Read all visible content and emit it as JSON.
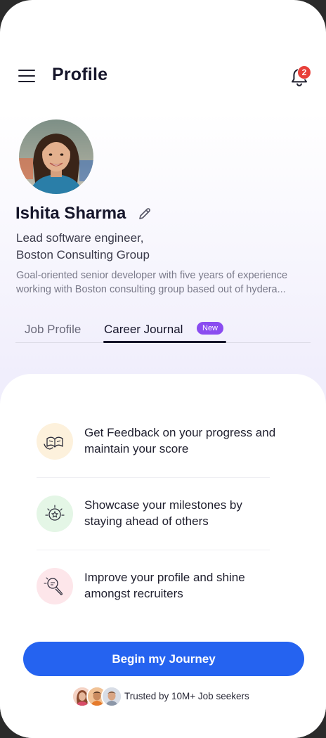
{
  "header": {
    "title": "Profile",
    "notification_count": "2"
  },
  "profile": {
    "name": "Ishita Sharma",
    "role_line1": "Lead software engineer,",
    "role_line2": "Boston Consulting Group",
    "bio_line1": "Goal-oriented senior developer with five years of experience",
    "bio_line2": "working with Boston consulting group based out of hydera..."
  },
  "tabs": [
    {
      "label": "Job Profile"
    },
    {
      "label": "Career Journal",
      "badge": "New"
    }
  ],
  "features": [
    {
      "line1": "Get Feedback on your progress and",
      "line2": "maintain your score",
      "icon": "feedback-book-icon",
      "bg": "#fdf1dc"
    },
    {
      "line1": "Showcase your milestones by",
      "line2": "staying ahead of others",
      "icon": "milestone-badge-icon",
      "bg": "#e4f6e6"
    },
    {
      "line1": "Improve your profile and shine",
      "line2": "amongst recruiters",
      "icon": "profile-magnifier-icon",
      "bg": "#fde6ea"
    }
  ],
  "cta": {
    "label": "Begin my Journey"
  },
  "trusted": {
    "text": "Trusted by 10M+ Job seekers"
  },
  "colors": {
    "accent": "#2563f0",
    "badge": "#8a4cf0",
    "notification": "#e8403a"
  }
}
